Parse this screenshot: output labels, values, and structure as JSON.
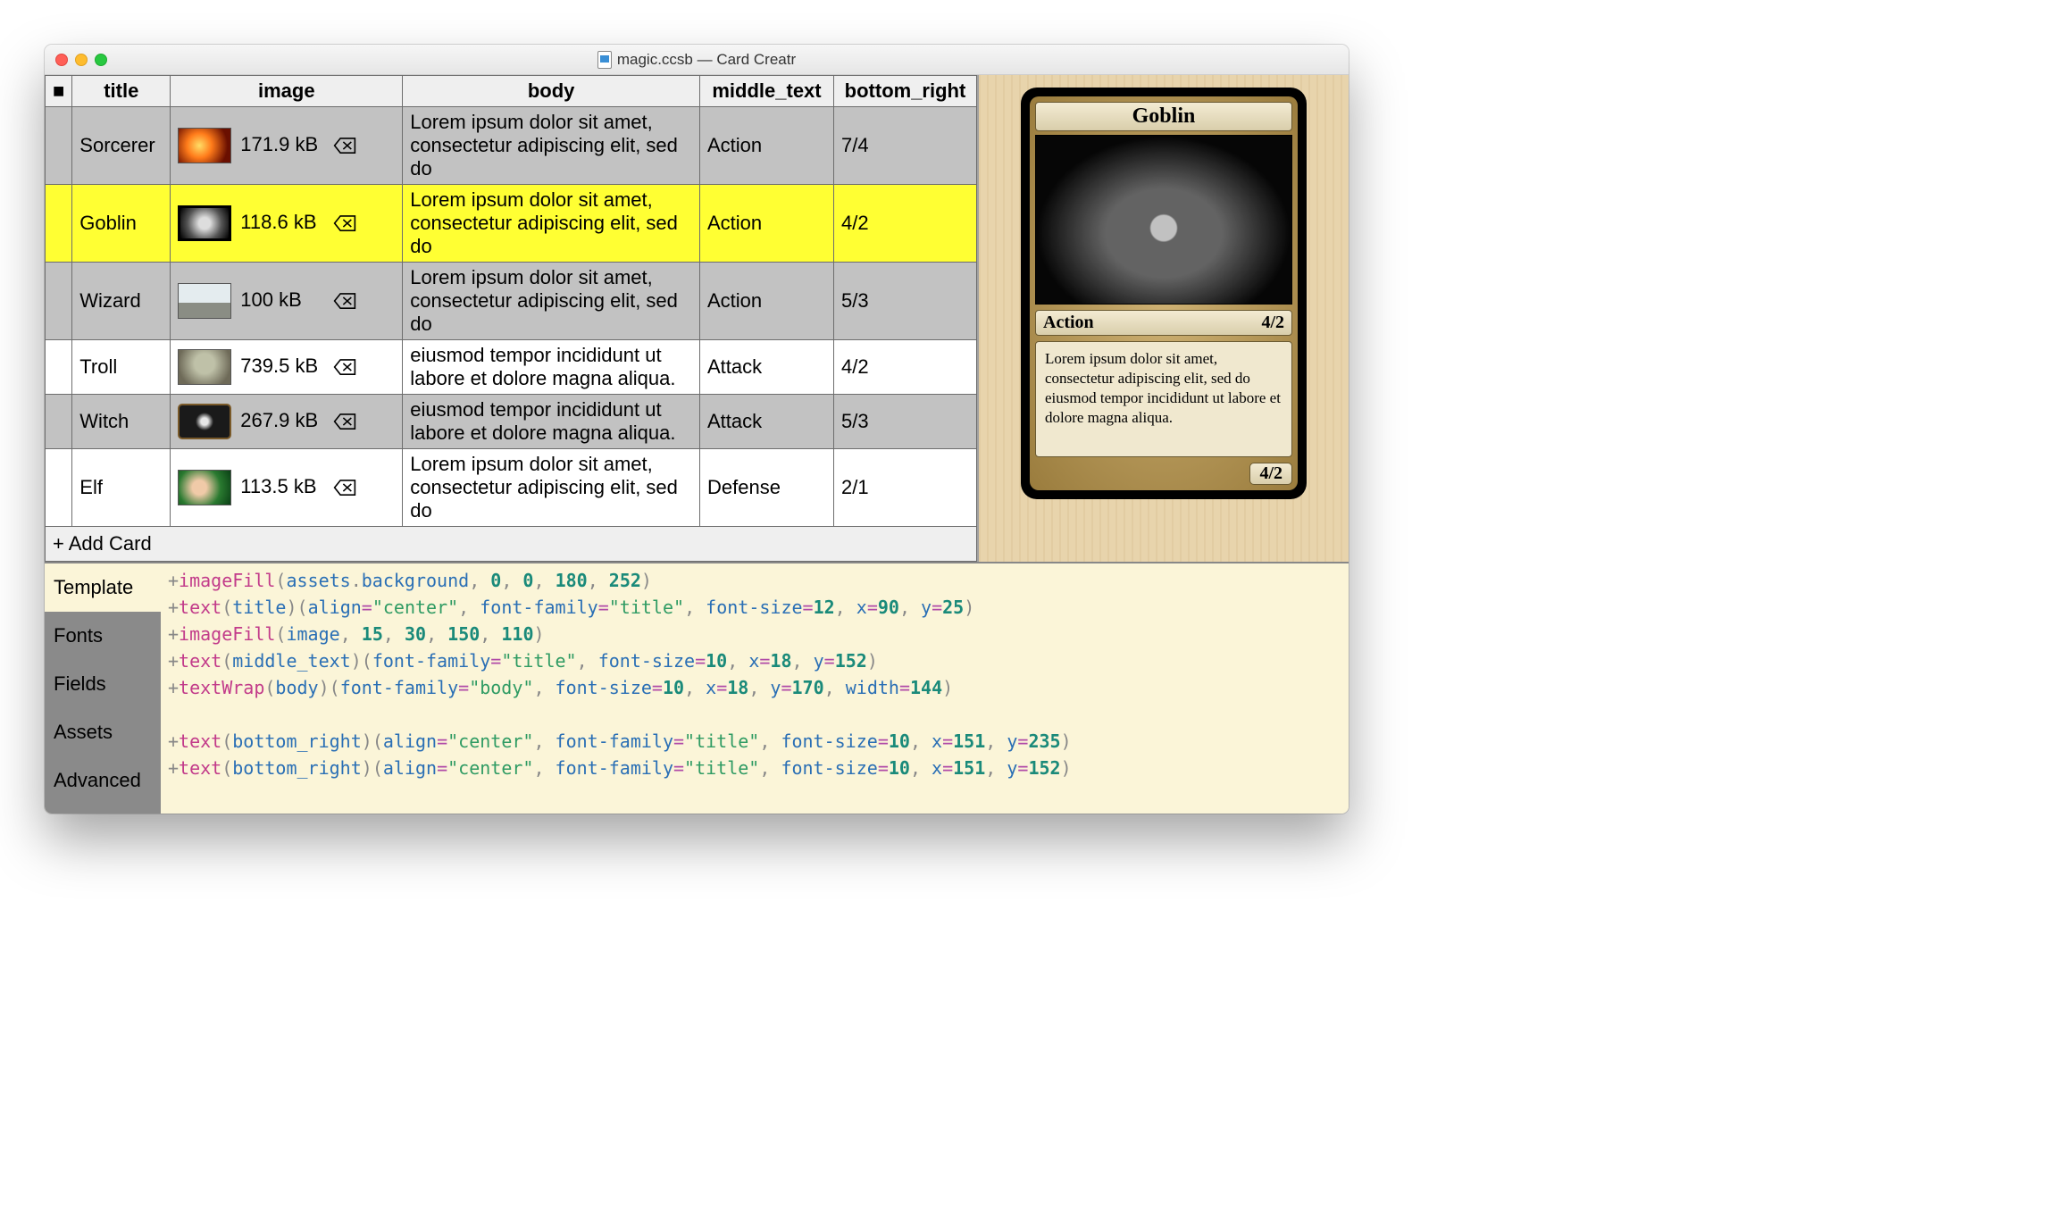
{
  "window": {
    "title": "magic.ccsb — Card Creatr"
  },
  "table": {
    "headers": {
      "check": "■",
      "title": "title",
      "image": "image",
      "body": "body",
      "middle_text": "middle_text",
      "bottom_right": "bottom_right"
    },
    "rows": [
      {
        "title": "Sorcerer",
        "size": "171.9 kB",
        "body": "Lorem ipsum dolor sit amet, consectetur adipiscing elit, sed do",
        "middle": "Action",
        "br": "7/4",
        "thumb": "fire"
      },
      {
        "title": "Goblin",
        "size": "118.6 kB",
        "body": "Lorem ipsum dolor sit amet, consectetur adipiscing elit, sed do",
        "middle": "Action",
        "br": "4/2",
        "thumb": "goblin",
        "selected": true
      },
      {
        "title": "Wizard",
        "size": "100 kB",
        "body": "Lorem ipsum dolor sit amet, consectetur adipiscing elit, sed do",
        "middle": "Action",
        "br": "5/3",
        "thumb": "wizard"
      },
      {
        "title": "Troll",
        "size": "739.5 kB",
        "body": "eiusmod tempor incididunt ut labore et dolore magna aliqua.",
        "middle": "Attack",
        "br": "4/2",
        "thumb": "troll"
      },
      {
        "title": "Witch",
        "size": "267.9 kB",
        "body": "eiusmod tempor incididunt ut labore et dolore magna aliqua.",
        "middle": "Attack",
        "br": "5/3",
        "thumb": "witch"
      },
      {
        "title": "Elf",
        "size": "113.5 kB",
        "body": "Lorem ipsum dolor sit amet, consectetur adipiscing elit, sed do",
        "middle": "Defense",
        "br": "2/1",
        "thumb": "elf"
      }
    ],
    "add_label": "+ Add Card"
  },
  "preview": {
    "title": "Goblin",
    "type": "Action",
    "stat": "4/2",
    "body": "Lorem ipsum dolor sit amet, consectetur adipiscing elit, sed do eiusmod tempor incididunt ut labore et dolore magna aliqua.",
    "bottom_stat": "4/2"
  },
  "tabs": {
    "items": [
      "Template",
      "Fonts",
      "Fields",
      "Assets",
      "Advanced"
    ],
    "active": 0
  },
  "code": {
    "lines": [
      [
        [
          "p",
          "+"
        ],
        [
          "fn",
          "imageFill"
        ],
        [
          "p",
          "("
        ],
        [
          "var",
          "assets"
        ],
        [
          "p",
          "."
        ],
        [
          "var",
          "background"
        ],
        [
          "p",
          ", "
        ],
        [
          "num",
          "0"
        ],
        [
          "p",
          ", "
        ],
        [
          "num",
          "0"
        ],
        [
          "p",
          ", "
        ],
        [
          "num",
          "180"
        ],
        [
          "p",
          ", "
        ],
        [
          "num",
          "252"
        ],
        [
          "p",
          ")"
        ]
      ],
      [
        [
          "p",
          "+"
        ],
        [
          "fn",
          "text"
        ],
        [
          "p",
          "("
        ],
        [
          "var",
          "title"
        ],
        [
          "p",
          ")"
        ],
        [
          "p",
          "("
        ],
        [
          "kw",
          "align"
        ],
        [
          "eq",
          "="
        ],
        [
          "str",
          "\"center\""
        ],
        [
          "p",
          ", "
        ],
        [
          "kw",
          "font-family"
        ],
        [
          "eq",
          "="
        ],
        [
          "str",
          "\"title\""
        ],
        [
          "p",
          ", "
        ],
        [
          "kw",
          "font-size"
        ],
        [
          "eq",
          "="
        ],
        [
          "num",
          "12"
        ],
        [
          "p",
          ", "
        ],
        [
          "kw",
          "x"
        ],
        [
          "eq",
          "="
        ],
        [
          "num",
          "90"
        ],
        [
          "p",
          ", "
        ],
        [
          "kw",
          "y"
        ],
        [
          "eq",
          "="
        ],
        [
          "num",
          "25"
        ],
        [
          "p",
          ")"
        ]
      ],
      [
        [
          "p",
          "+"
        ],
        [
          "fn",
          "imageFill"
        ],
        [
          "p",
          "("
        ],
        [
          "var",
          "image"
        ],
        [
          "p",
          ", "
        ],
        [
          "num",
          "15"
        ],
        [
          "p",
          ", "
        ],
        [
          "num",
          "30"
        ],
        [
          "p",
          ", "
        ],
        [
          "num",
          "150"
        ],
        [
          "p",
          ", "
        ],
        [
          "num",
          "110"
        ],
        [
          "p",
          ")"
        ]
      ],
      [
        [
          "p",
          "+"
        ],
        [
          "fn",
          "text"
        ],
        [
          "p",
          "("
        ],
        [
          "var",
          "middle_text"
        ],
        [
          "p",
          ")"
        ],
        [
          "p",
          "("
        ],
        [
          "kw",
          "font-family"
        ],
        [
          "eq",
          "="
        ],
        [
          "str",
          "\"title\""
        ],
        [
          "p",
          ", "
        ],
        [
          "kw",
          "font-size"
        ],
        [
          "eq",
          "="
        ],
        [
          "num",
          "10"
        ],
        [
          "p",
          ", "
        ],
        [
          "kw",
          "x"
        ],
        [
          "eq",
          "="
        ],
        [
          "num",
          "18"
        ],
        [
          "p",
          ", "
        ],
        [
          "kw",
          "y"
        ],
        [
          "eq",
          "="
        ],
        [
          "num",
          "152"
        ],
        [
          "p",
          ")"
        ]
      ],
      [
        [
          "p",
          "+"
        ],
        [
          "fn",
          "textWrap"
        ],
        [
          "p",
          "("
        ],
        [
          "var",
          "body"
        ],
        [
          "p",
          ")"
        ],
        [
          "p",
          "("
        ],
        [
          "kw",
          "font-family"
        ],
        [
          "eq",
          "="
        ],
        [
          "str",
          "\"body\""
        ],
        [
          "p",
          ", "
        ],
        [
          "kw",
          "font-size"
        ],
        [
          "eq",
          "="
        ],
        [
          "num",
          "10"
        ],
        [
          "p",
          ", "
        ],
        [
          "kw",
          "x"
        ],
        [
          "eq",
          "="
        ],
        [
          "num",
          "18"
        ],
        [
          "p",
          ", "
        ],
        [
          "kw",
          "y"
        ],
        [
          "eq",
          "="
        ],
        [
          "num",
          "170"
        ],
        [
          "p",
          ", "
        ],
        [
          "kw",
          "width"
        ],
        [
          "eq",
          "="
        ],
        [
          "num",
          "144"
        ],
        [
          "p",
          ")"
        ]
      ],
      [],
      [
        [
          "p",
          "+"
        ],
        [
          "fn",
          "text"
        ],
        [
          "p",
          "("
        ],
        [
          "var",
          "bottom_right"
        ],
        [
          "p",
          ")"
        ],
        [
          "p",
          "("
        ],
        [
          "kw",
          "align"
        ],
        [
          "eq",
          "="
        ],
        [
          "str",
          "\"center\""
        ],
        [
          "p",
          ", "
        ],
        [
          "kw",
          "font-family"
        ],
        [
          "eq",
          "="
        ],
        [
          "str",
          "\"title\""
        ],
        [
          "p",
          ", "
        ],
        [
          "kw",
          "font-size"
        ],
        [
          "eq",
          "="
        ],
        [
          "num",
          "10"
        ],
        [
          "p",
          ", "
        ],
        [
          "kw",
          "x"
        ],
        [
          "eq",
          "="
        ],
        [
          "num",
          "151"
        ],
        [
          "p",
          ", "
        ],
        [
          "kw",
          "y"
        ],
        [
          "eq",
          "="
        ],
        [
          "num",
          "235"
        ],
        [
          "p",
          ")"
        ]
      ],
      [
        [
          "p",
          "+"
        ],
        [
          "fn",
          "text"
        ],
        [
          "p",
          "("
        ],
        [
          "var",
          "bottom_right"
        ],
        [
          "p",
          ")"
        ],
        [
          "p",
          "("
        ],
        [
          "kw",
          "align"
        ],
        [
          "eq",
          "="
        ],
        [
          "str",
          "\"center\""
        ],
        [
          "p",
          ", "
        ],
        [
          "kw",
          "font-family"
        ],
        [
          "eq",
          "="
        ],
        [
          "str",
          "\"title\""
        ],
        [
          "p",
          ", "
        ],
        [
          "kw",
          "font-size"
        ],
        [
          "eq",
          "="
        ],
        [
          "num",
          "10"
        ],
        [
          "p",
          ", "
        ],
        [
          "kw",
          "x"
        ],
        [
          "eq",
          "="
        ],
        [
          "num",
          "151"
        ],
        [
          "p",
          ", "
        ],
        [
          "kw",
          "y"
        ],
        [
          "eq",
          "="
        ],
        [
          "num",
          "152"
        ],
        [
          "p",
          ")"
        ]
      ]
    ]
  }
}
